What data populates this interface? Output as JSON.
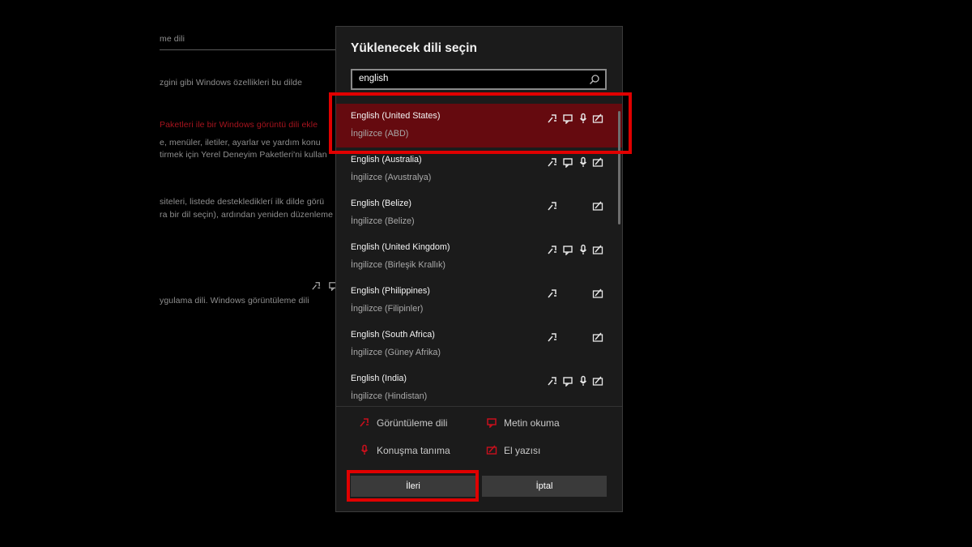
{
  "background": {
    "lines": [
      "me dili",
      "zgini gibi Windows özellikleri bu dilde",
      "Paketleri ile bir Windows görüntü dili ekle",
      "e, menüler, iletiler, ayarlar ve yardım konu",
      "tirmek için Yerel Deneyim Paketleri'ni kullan",
      "siteleri, listede desteklediklerí ilk dilde görü",
      "ra bir dil seçin), ardından yeniden düzenleme",
      "ygulama dili. Windows görüntüleme dili"
    ]
  },
  "dialog": {
    "title": "Yüklenecek dili seçin",
    "search": {
      "value": "english"
    },
    "languages": [
      {
        "name": "English (United States)",
        "native": "İngilizce (ABD)",
        "selected": true,
        "features": [
          "display",
          "tts",
          "speech",
          "handwriting"
        ]
      },
      {
        "name": "English (Australia)",
        "native": "İngilizce (Avustralya)",
        "selected": false,
        "features": [
          "display",
          "tts",
          "speech",
          "handwriting"
        ]
      },
      {
        "name": "English (Belize)",
        "native": "İngilizce (Belize)",
        "selected": false,
        "features": [
          "display",
          "handwriting"
        ]
      },
      {
        "name": "English (United Kingdom)",
        "native": "İngilizce (Birleşik Krallık)",
        "selected": false,
        "features": [
          "display",
          "tts",
          "speech",
          "handwriting"
        ]
      },
      {
        "name": "English (Philippines)",
        "native": "İngilizce (Filipinler)",
        "selected": false,
        "features": [
          "display",
          "handwriting"
        ]
      },
      {
        "name": "English (South Africa)",
        "native": "İngilizce (Güney Afrika)",
        "selected": false,
        "features": [
          "display",
          "handwriting"
        ]
      },
      {
        "name": "English (India)",
        "native": "İngilizce (Hindistan)",
        "selected": false,
        "features": [
          "display",
          "tts",
          "speech",
          "handwriting"
        ]
      }
    ],
    "legend": {
      "display": "Görüntüleme dili",
      "tts": "Metin okuma",
      "speech": "Konuşma tanıma",
      "handwriting": "El yazısı"
    },
    "buttons": {
      "next": "İleri",
      "cancel": "İptal"
    }
  },
  "colors": {
    "accent": "#e00000",
    "selected_bg": "#650a0f",
    "legend_icon": "#c8101c"
  }
}
